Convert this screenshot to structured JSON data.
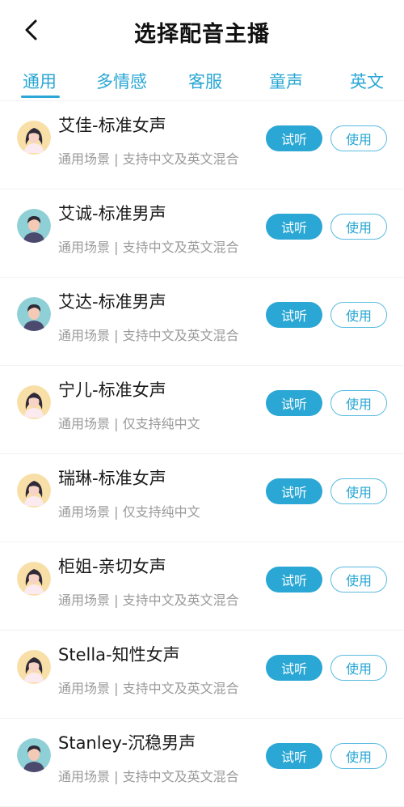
{
  "header": {
    "title": "选择配音主播",
    "back_icon": "chevron-left-icon"
  },
  "tabs": [
    {
      "label": "通用",
      "active": true
    },
    {
      "label": "多情感"
    },
    {
      "label": "客服"
    },
    {
      "label": "童声"
    },
    {
      "label": "英文"
    }
  ],
  "colors": {
    "accent": "#2aa7d4",
    "female_avatar_bg": "#f8dfa7",
    "male_avatar_bg": "#8fd0d6"
  },
  "voices": [
    {
      "name": "艾佳-标准女声",
      "desc": "通用场景 | 支持中文及英文混合",
      "gender": "female",
      "try_label": "试听",
      "use_label": "使用"
    },
    {
      "name": "艾诚-标准男声",
      "desc": "通用场景 | 支持中文及英文混合",
      "gender": "male",
      "try_label": "试听",
      "use_label": "使用"
    },
    {
      "name": "艾达-标准男声",
      "desc": "通用场景 | 支持中文及英文混合",
      "gender": "male",
      "try_label": "试听",
      "use_label": "使用"
    },
    {
      "name": "宁儿-标准女声",
      "desc": "通用场景 | 仅支持纯中文",
      "gender": "female",
      "try_label": "试听",
      "use_label": "使用"
    },
    {
      "name": "瑞琳-标准女声",
      "desc": "通用场景 | 仅支持纯中文",
      "gender": "female",
      "try_label": "试听",
      "use_label": "使用"
    },
    {
      "name": "柜姐-亲切女声",
      "desc": "通用场景 | 支持中文及英文混合",
      "gender": "female",
      "try_label": "试听",
      "use_label": "使用"
    },
    {
      "name": "Stella-知性女声",
      "desc": "通用场景 | 支持中文及英文混合",
      "gender": "female",
      "try_label": "试听",
      "use_label": "使用"
    },
    {
      "name": "Stanley-沉稳男声",
      "desc": "通用场景 | 支持中文及英文混合",
      "gender": "male",
      "try_label": "试听",
      "use_label": "使用"
    }
  ]
}
